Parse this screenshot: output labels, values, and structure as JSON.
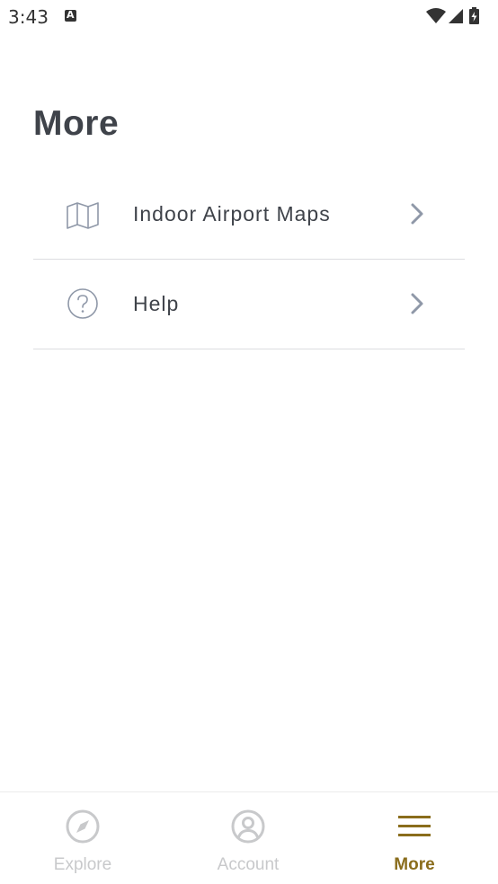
{
  "status_bar": {
    "time": "3:43",
    "icons": [
      "notification-a-icon",
      "wifi-icon",
      "cell-signal-icon",
      "battery-charging-icon"
    ]
  },
  "page": {
    "title": "More"
  },
  "menu": {
    "items": [
      {
        "label": "Indoor Airport Maps",
        "icon": "map-icon"
      },
      {
        "label": "Help",
        "icon": "help-circle-icon"
      }
    ]
  },
  "bottom_nav": {
    "items": [
      {
        "label": "Explore",
        "icon": "compass-icon",
        "active": false
      },
      {
        "label": "Account",
        "icon": "user-circle-icon",
        "active": false
      },
      {
        "label": "More",
        "icon": "menu-icon",
        "active": true
      }
    ]
  },
  "colors": {
    "accent": "#8a6d1c",
    "text": "#3f434a",
    "inactive": "#c8c9cb",
    "divider": "#dcdde0",
    "chevron": "#8f98a8"
  }
}
